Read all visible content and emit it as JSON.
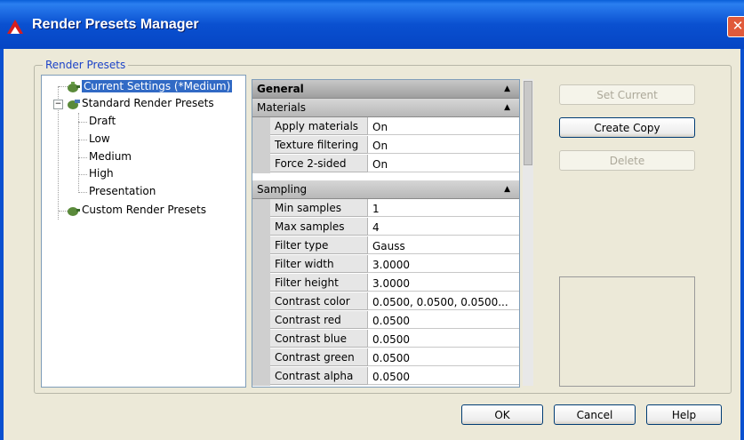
{
  "window": {
    "title": "Render Presets Manager",
    "close_glyph": "✕"
  },
  "group": {
    "label": "Render Presets"
  },
  "tree": {
    "expander": "−",
    "items": [
      {
        "label": "Current Settings (*Medium)"
      },
      {
        "label": "Standard Render Presets"
      },
      {
        "label": "Draft"
      },
      {
        "label": "Low"
      },
      {
        "label": "Medium"
      },
      {
        "label": "High"
      },
      {
        "label": "Presentation"
      },
      {
        "label": "Custom Render Presets"
      }
    ]
  },
  "grid": {
    "arrow": "▲",
    "general": "General",
    "materials": {
      "label": "Materials",
      "rows": [
        {
          "name": "Apply materials",
          "value": "On"
        },
        {
          "name": "Texture filtering",
          "value": "On"
        },
        {
          "name": "Force 2-sided",
          "value": "On"
        }
      ]
    },
    "sampling": {
      "label": "Sampling",
      "rows": [
        {
          "name": "Min samples",
          "value": "1"
        },
        {
          "name": "Max samples",
          "value": "4"
        },
        {
          "name": "Filter type",
          "value": "Gauss"
        },
        {
          "name": "Filter width",
          "value": "3.0000"
        },
        {
          "name": "Filter height",
          "value": "3.0000"
        },
        {
          "name": "Contrast color",
          "value": "0.0500, 0.0500, 0.0500..."
        },
        {
          "name": "Contrast red",
          "value": "0.0500"
        },
        {
          "name": "Contrast blue",
          "value": "0.0500"
        },
        {
          "name": "Contrast green",
          "value": "0.0500"
        },
        {
          "name": "Contrast alpha",
          "value": "0.0500"
        }
      ]
    }
  },
  "buttons": {
    "set_current": "Set Current",
    "create_copy": "Create Copy",
    "delete": "Delete",
    "ok": "OK",
    "cancel": "Cancel",
    "help": "Help"
  }
}
